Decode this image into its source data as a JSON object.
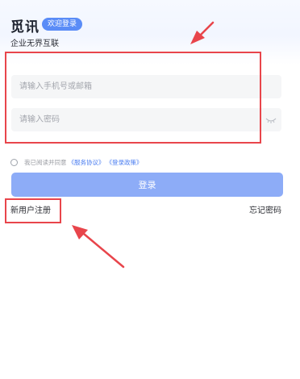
{
  "header": {
    "brand": "觅讯",
    "welcome_badge": "欢迎登录",
    "subtitle": "企业无界互联"
  },
  "form": {
    "account_placeholder": "请输入手机号或邮箱",
    "password_placeholder": "请输入密码"
  },
  "agreement": {
    "text": "我已阅读并同意",
    "service_link": "《服务协议》",
    "privacy_link": "《登录政策》"
  },
  "login_button": "登录",
  "links": {
    "register": "新用户注册",
    "forgot": "忘记密码"
  },
  "colors": {
    "accent": "#5a8cf7",
    "button": "#8dacf7",
    "highlight": "#e8454b"
  }
}
